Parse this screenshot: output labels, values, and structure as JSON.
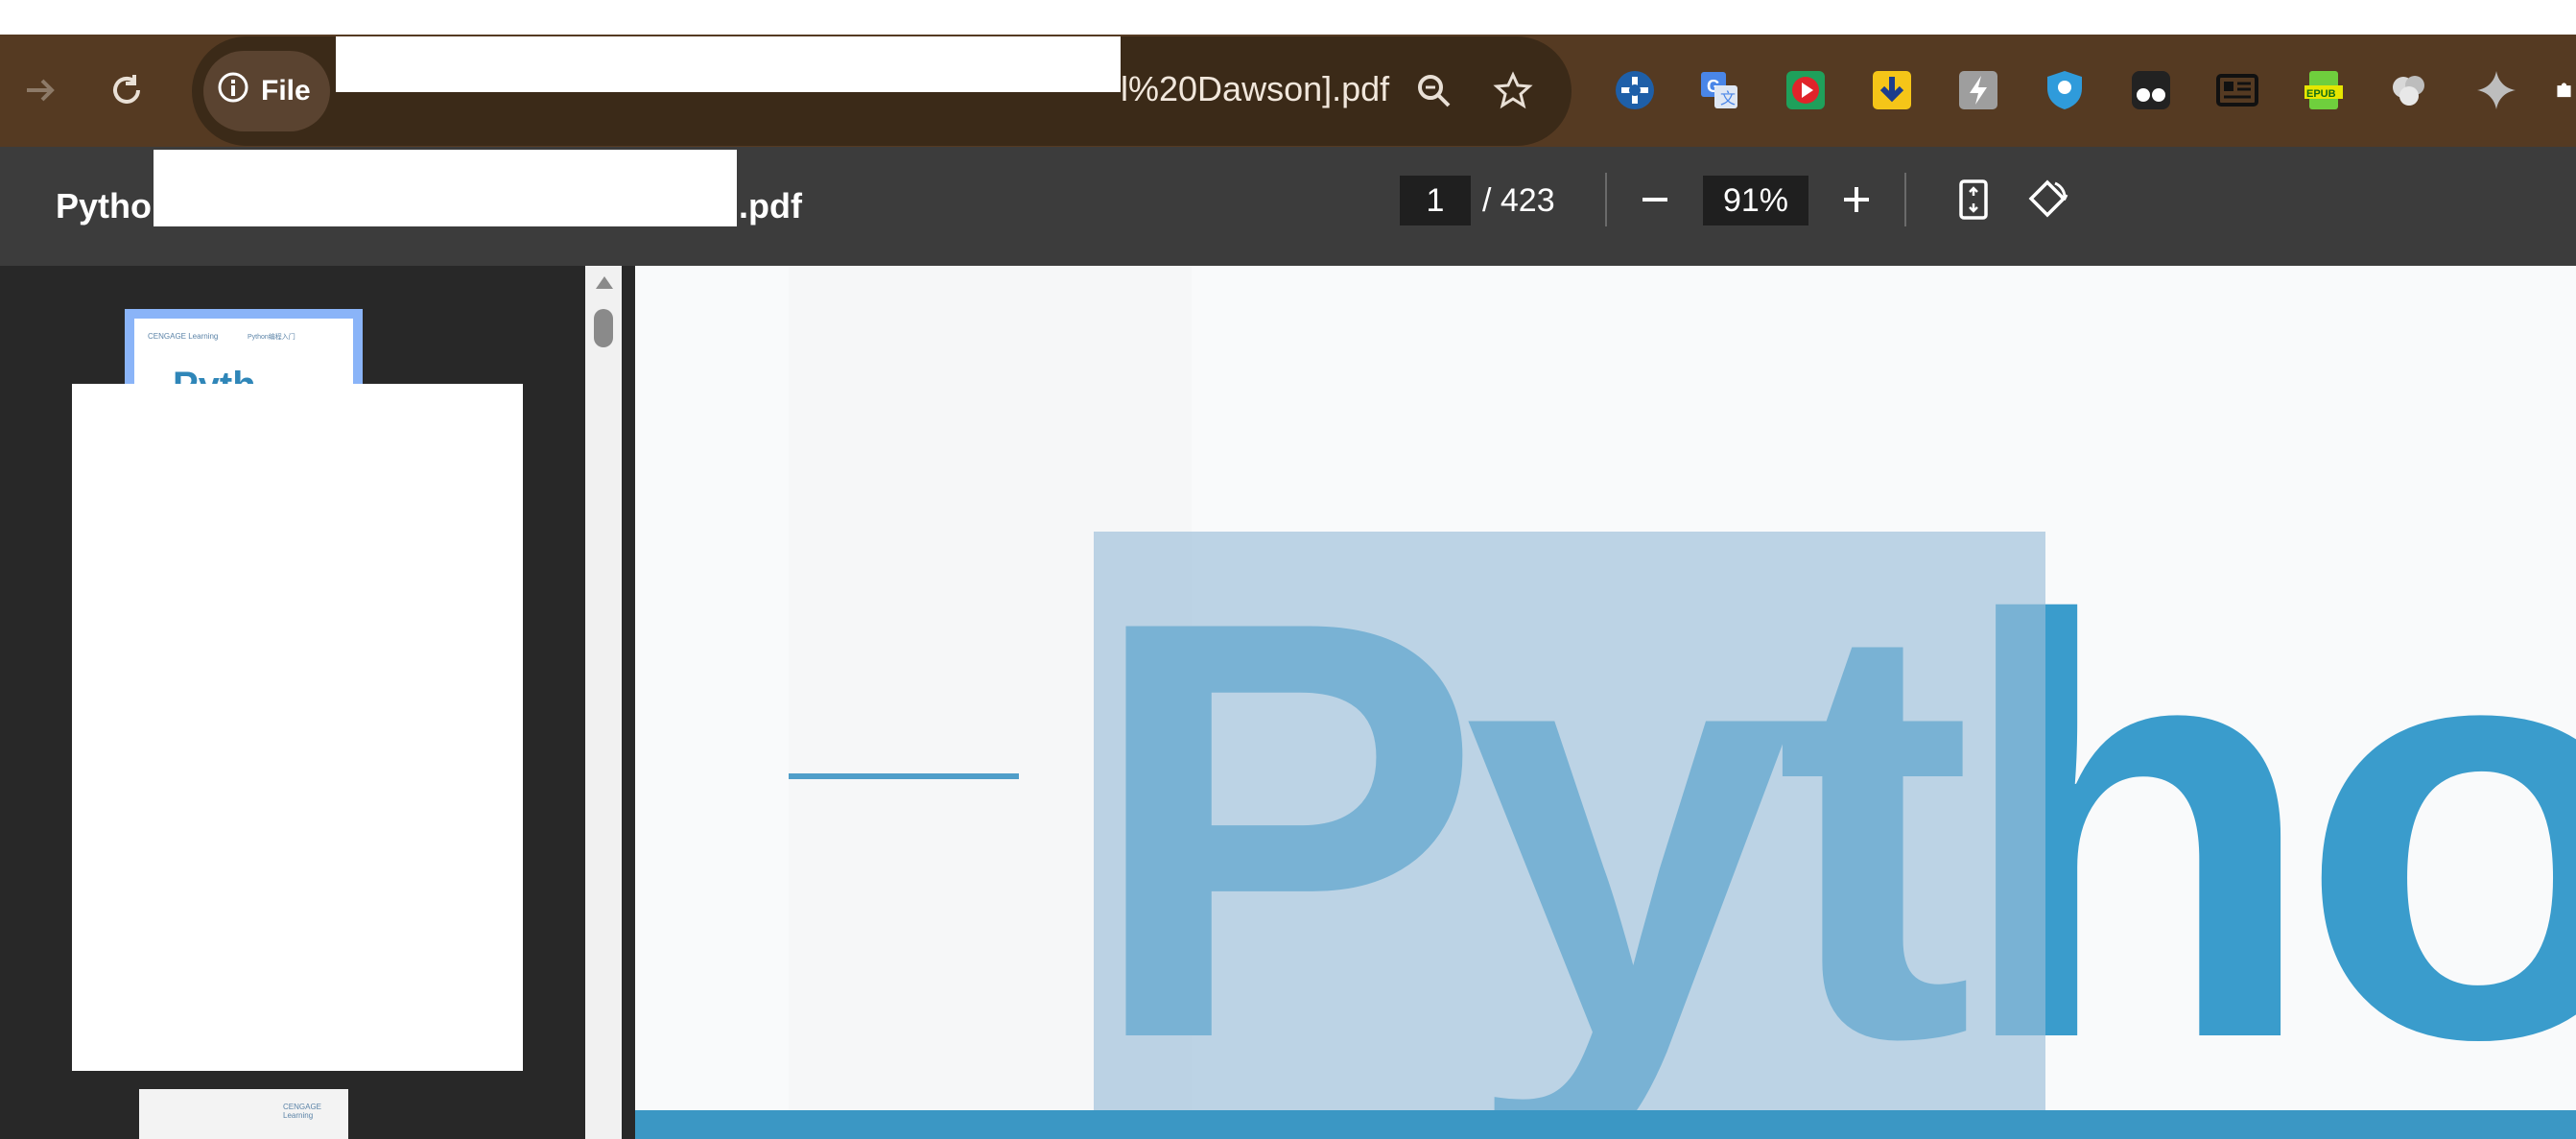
{
  "browser": {
    "chip_label": "File",
    "url_tail": "l%20Dawson].pdf",
    "icons": [
      "back-arrow-icon",
      "reload-icon",
      "info-icon",
      "zoom-icon",
      "star-icon"
    ],
    "extensions": [
      "ext-cross-icon",
      "google-translate-icon",
      "video-play-icon",
      "download-icon",
      "bolt-icon",
      "shield-icon",
      "goggles-icon",
      "reader-icon",
      "epub-icon",
      "circles-icon",
      "sparkle-icon"
    ]
  },
  "pdf_toolbar": {
    "title_prefix": "Python",
    "title_suffix": ".pdf",
    "current_page": "1",
    "total_pages": "/ 423",
    "zoom": "91%"
  },
  "thumbnails": {
    "cover_mini_title": "Pyth",
    "cover_logo": "CENGAGE Learning",
    "cover_cn": "Python编程入门"
  },
  "page_view": {
    "cover_word": "Python",
    "colors": {
      "title_blue": "#3a9ccc",
      "selection": "#9bbfd9",
      "rule_blue": "#3b97c4"
    }
  }
}
